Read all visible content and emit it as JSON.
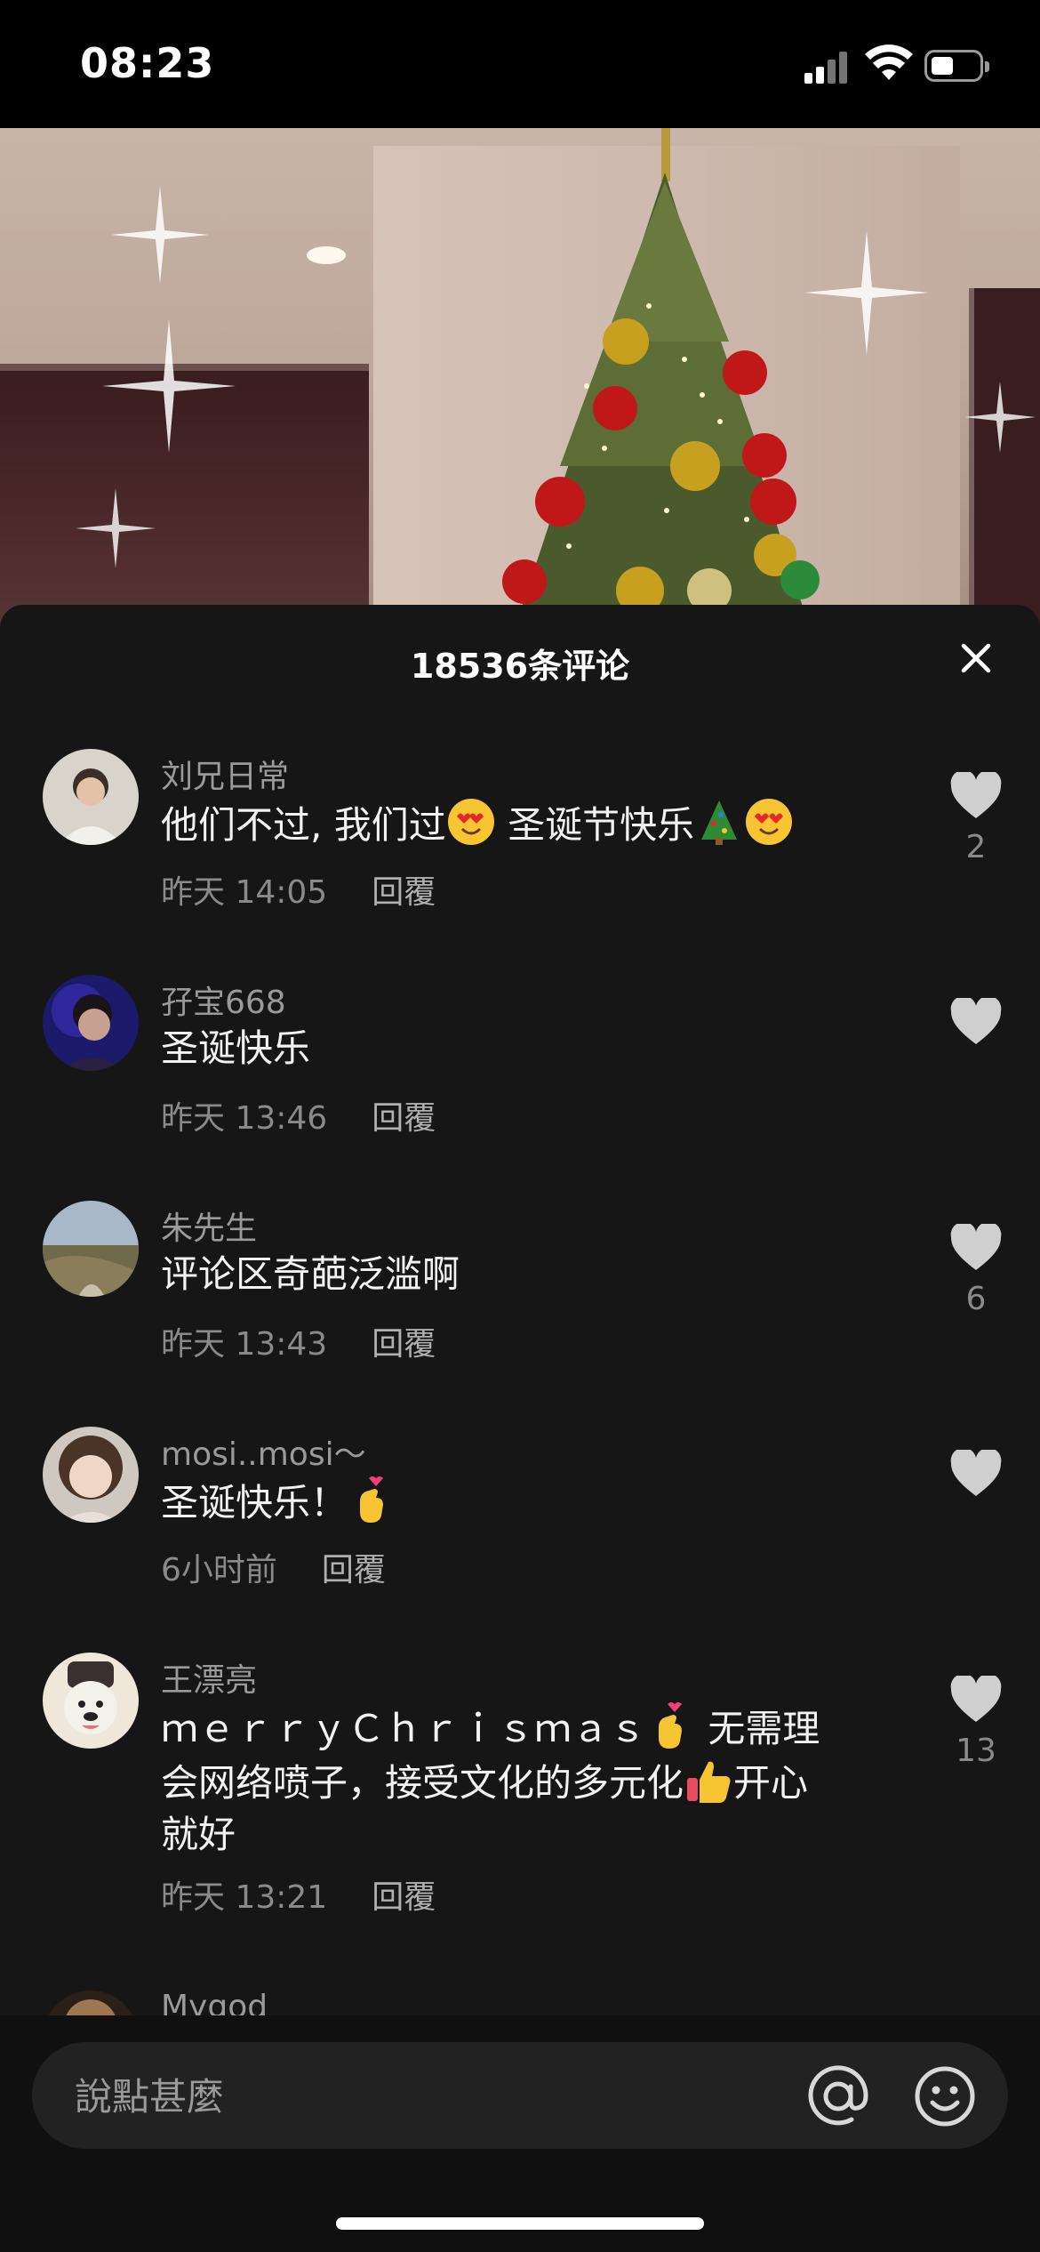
{
  "status_bar": {
    "time": "08:23"
  },
  "comments_panel": {
    "title": "18536条评论",
    "comments": [
      {
        "author": "刘兄日常",
        "text": "他们不过, 我们过",
        "text_after_emoji": "圣诞节快乐",
        "time": "昨天 14:05",
        "reply_label": "回覆",
        "likes": "2",
        "emojis": [
          "heart-eyes-emoji",
          "christmas-tree-emoji",
          "heart-eyes-emoji"
        ]
      },
      {
        "author": "孖宝668",
        "text": "圣诞快乐",
        "time": "昨天 13:46",
        "reply_label": "回覆",
        "likes": ""
      },
      {
        "author": "朱先生",
        "text": "评论区奇葩泛滥啊",
        "time": "昨天 13:43",
        "reply_label": "回覆",
        "likes": "6"
      },
      {
        "author": "mosi..mosi～",
        "text": "圣诞快乐！",
        "time": "6小时前",
        "reply_label": "回覆",
        "likes": "",
        "emojis": [
          "finger-heart-emoji"
        ]
      },
      {
        "author": "王漂亮",
        "text_line1": "ｍｅｒｒｙＣｈｒｉｓｍａｓ",
        "text_line1b": "无需理",
        "text_line2": "会网络喷子，接受文化的多元化",
        "text_line2b": "开心",
        "text_line3": "就好",
        "time": "昨天 13:21",
        "reply_label": "回覆",
        "likes": "13",
        "emojis": [
          "finger-heart-emoji",
          "thumbs-up-emoji"
        ]
      },
      {
        "author": "Mygod"
      }
    ]
  },
  "input_bar": {
    "placeholder": "說點甚麼"
  },
  "icons": [
    "close-icon",
    "heart-icon",
    "at-icon",
    "emoji-icon",
    "signal-icon",
    "wifi-icon",
    "battery-icon"
  ]
}
